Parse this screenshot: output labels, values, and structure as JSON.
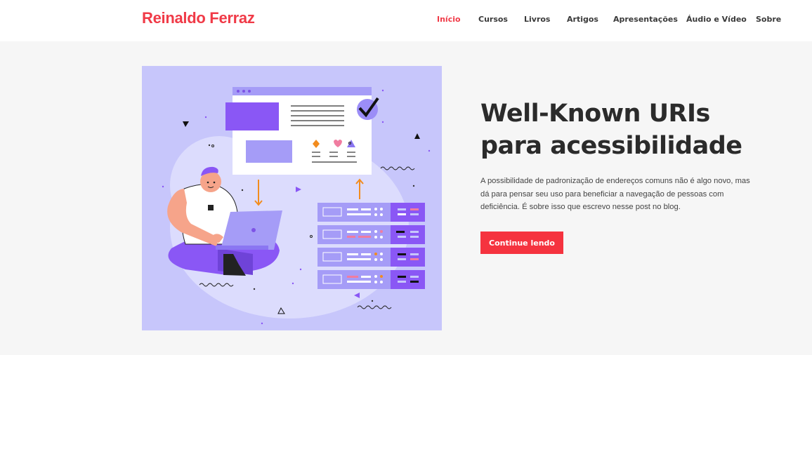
{
  "site": {
    "logo": "Reinaldo Ferraz"
  },
  "nav": {
    "items": [
      {
        "label": "Início",
        "active": true
      },
      {
        "label": "Cursos"
      },
      {
        "label": "Livros"
      },
      {
        "label": "Artigos"
      },
      {
        "label": "Apresentações"
      },
      {
        "label": "Áudio e Vídeo"
      },
      {
        "label": "Sobre"
      }
    ]
  },
  "post": {
    "title": "Well-Known URIs para acessibilidade",
    "excerpt": "A possibilidade de padronização de endereços comuns não é algo novo, mas dá para pensar seu uso para beneficiar a navegação de pessoas com deficiência. É sobre isso que escrevo nesse post no blog.",
    "cta_label": "Continue lendo"
  },
  "colors": {
    "brand": "#f03a47",
    "button": "#f5333f",
    "hero_bg": "#f6f6f6",
    "illustration_bg": "#c7c6fb",
    "illustration_accent": "#8a57f5"
  },
  "illustration": {
    "icon": "developer-laptop-servers-illustration"
  }
}
